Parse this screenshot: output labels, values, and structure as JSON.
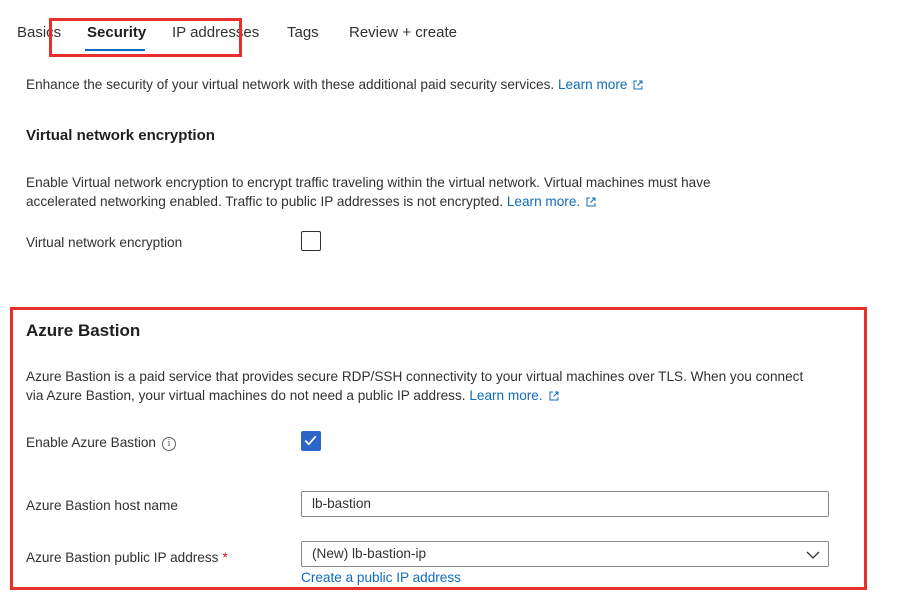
{
  "tabs": [
    {
      "label": "Basics"
    },
    {
      "label": "Security"
    },
    {
      "label": "IP addresses"
    },
    {
      "label": "Tags"
    },
    {
      "label": "Review + create"
    }
  ],
  "intro": {
    "text": "Enhance the security of your virtual network with these additional paid security services.",
    "link": "Learn more"
  },
  "vnet_encryption": {
    "heading": "Virtual network encryption",
    "desc_line1": "Enable Virtual network encryption to encrypt traffic traveling within the virtual network. Virtual machines must have",
    "desc_line2": "accelerated networking enabled. Traffic to public IP addresses is not encrypted.",
    "link": "Learn more.",
    "field_label": "Virtual network encryption",
    "checked": false
  },
  "bastion": {
    "heading": "Azure Bastion",
    "desc_line1": "Azure Bastion is a paid service that provides secure RDP/SSH connectivity to your virtual machines over TLS. When you connect",
    "desc_line2": "via Azure Bastion, your virtual machines do not need a public IP address.",
    "link": "Learn more.",
    "enable_label": "Enable Azure Bastion",
    "enable_checked": true,
    "host_label": "Azure Bastion host name",
    "host_value": "lb-bastion",
    "ip_label": "Azure Bastion public IP address",
    "required_mark": "*",
    "ip_value": "(New) lb-bastion-ip",
    "create_ip_link": "Create a public IP address"
  },
  "colors": {
    "link": "#0f6cbd",
    "checkbox_checked": "#2c65c8",
    "highlight": "#e8302a"
  }
}
